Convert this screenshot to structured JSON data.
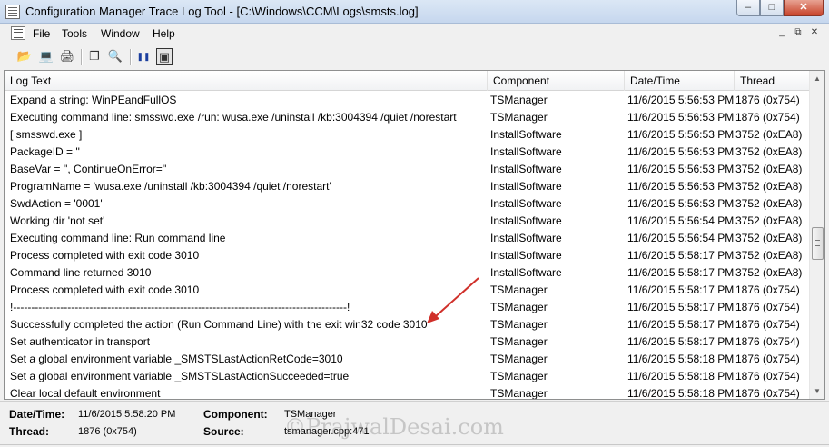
{
  "window": {
    "title": "Configuration Manager Trace Log Tool - [C:\\Windows\\CCM\\Logs\\smsts.log]",
    "minimize": "–",
    "restore": "□",
    "close": "✕"
  },
  "menu": {
    "items": [
      "File",
      "Tools",
      "Window",
      "Help"
    ],
    "mdi_minimize": "_",
    "mdi_restore": "⧉",
    "mdi_close": "✕"
  },
  "toolbar": {
    "icons": [
      "open-folder-icon",
      "open-computer-icon",
      "print-icon",
      "copy-icon",
      "find-icon",
      "pause-icon",
      "highlight-icon"
    ],
    "glyphs": [
      "📂",
      "💻",
      "🖨",
      "❐",
      "🔍",
      "❚❚",
      "▣"
    ]
  },
  "grid": {
    "columns": [
      "Log Text",
      "Component",
      "Date/Time",
      "Thread"
    ],
    "rows": [
      {
        "text": "Expand a string: WinPEandFullOS",
        "component": "TSManager",
        "datetime": "11/6/2015 5:56:53 PM",
        "thread": "1876 (0x754)"
      },
      {
        "text": "Executing command line: smsswd.exe /run: wusa.exe /uninstall /kb:3004394 /quiet /norestart",
        "component": "TSManager",
        "datetime": "11/6/2015 5:56:53 PM",
        "thread": "1876 (0x754)"
      },
      {
        "text": "[ smsswd.exe ]",
        "component": "InstallSoftware",
        "datetime": "11/6/2015 5:56:53 PM",
        "thread": "3752 (0xEA8)"
      },
      {
        "text": "PackageID = ''",
        "component": "InstallSoftware",
        "datetime": "11/6/2015 5:56:53 PM",
        "thread": "3752 (0xEA8)"
      },
      {
        "text": "BaseVar = '', ContinueOnError=''",
        "component": "InstallSoftware",
        "datetime": "11/6/2015 5:56:53 PM",
        "thread": "3752 (0xEA8)"
      },
      {
        "text": "ProgramName = 'wusa.exe /uninstall /kb:3004394 /quiet /norestart'",
        "component": "InstallSoftware",
        "datetime": "11/6/2015 5:56:53 PM",
        "thread": "3752 (0xEA8)"
      },
      {
        "text": "SwdAction = '0001'",
        "component": "InstallSoftware",
        "datetime": "11/6/2015 5:56:53 PM",
        "thread": "3752 (0xEA8)"
      },
      {
        "text": "Working dir 'not set'",
        "component": "InstallSoftware",
        "datetime": "11/6/2015 5:56:54 PM",
        "thread": "3752 (0xEA8)"
      },
      {
        "text": "Executing command line: Run command line",
        "component": "InstallSoftware",
        "datetime": "11/6/2015 5:56:54 PM",
        "thread": "3752 (0xEA8)"
      },
      {
        "text": "Process completed with exit code 3010",
        "component": "InstallSoftware",
        "datetime": "11/6/2015 5:58:17 PM",
        "thread": "3752 (0xEA8)"
      },
      {
        "text": "Command line returned 3010",
        "component": "InstallSoftware",
        "datetime": "11/6/2015 5:58:17 PM",
        "thread": "3752 (0xEA8)"
      },
      {
        "text": "Process completed with exit code 3010",
        "component": "TSManager",
        "datetime": "11/6/2015 5:58:17 PM",
        "thread": "1876 (0x754)"
      },
      {
        "text": "!--------------------------------------------------------------------------------------------!",
        "component": "TSManager",
        "datetime": "11/6/2015 5:58:17 PM",
        "thread": "1876 (0x754)"
      },
      {
        "text": "Successfully completed the action (Run Command Line) with the exit win32 code 3010",
        "component": "TSManager",
        "datetime": "11/6/2015 5:58:17 PM",
        "thread": "1876 (0x754)"
      },
      {
        "text": "Set authenticator in transport",
        "component": "TSManager",
        "datetime": "11/6/2015 5:58:17 PM",
        "thread": "1876 (0x754)"
      },
      {
        "text": "Set a global environment variable _SMSTSLastActionRetCode=3010",
        "component": "TSManager",
        "datetime": "11/6/2015 5:58:18 PM",
        "thread": "1876 (0x754)"
      },
      {
        "text": "Set a global environment variable _SMSTSLastActionSucceeded=true",
        "component": "TSManager",
        "datetime": "11/6/2015 5:58:18 PM",
        "thread": "1876 (0x754)"
      },
      {
        "text": "Clear local default environment",
        "component": "TSManager",
        "datetime": "11/6/2015 5:58:18 PM",
        "thread": "1876 (0x754)"
      }
    ]
  },
  "details": {
    "datetime_label": "Date/Time:",
    "datetime_value": "11/6/2015 5:58:20 PM",
    "component_label": "Component:",
    "component_value": "TSManager",
    "thread_label": "Thread:",
    "thread_value": "1876 (0x754)",
    "source_label": "Source:",
    "source_value": "tsmanager.cpp:471",
    "watermark": "©PrajwalDesai.com"
  },
  "colors": {
    "annotation_arrow": "#d0302a"
  }
}
